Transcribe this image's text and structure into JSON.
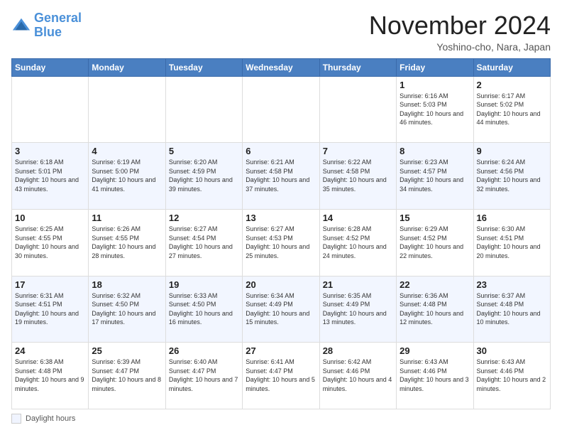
{
  "logo": {
    "line1": "General",
    "line2": "Blue"
  },
  "title": "November 2024",
  "location": "Yoshino-cho, Nara, Japan",
  "days_of_week": [
    "Sunday",
    "Monday",
    "Tuesday",
    "Wednesday",
    "Thursday",
    "Friday",
    "Saturday"
  ],
  "legend_label": "Daylight hours",
  "weeks": [
    [
      {
        "day": "",
        "info": ""
      },
      {
        "day": "",
        "info": ""
      },
      {
        "day": "",
        "info": ""
      },
      {
        "day": "",
        "info": ""
      },
      {
        "day": "",
        "info": ""
      },
      {
        "day": "1",
        "info": "Sunrise: 6:16 AM\nSunset: 5:03 PM\nDaylight: 10 hours and 46 minutes."
      },
      {
        "day": "2",
        "info": "Sunrise: 6:17 AM\nSunset: 5:02 PM\nDaylight: 10 hours and 44 minutes."
      }
    ],
    [
      {
        "day": "3",
        "info": "Sunrise: 6:18 AM\nSunset: 5:01 PM\nDaylight: 10 hours and 43 minutes."
      },
      {
        "day": "4",
        "info": "Sunrise: 6:19 AM\nSunset: 5:00 PM\nDaylight: 10 hours and 41 minutes."
      },
      {
        "day": "5",
        "info": "Sunrise: 6:20 AM\nSunset: 4:59 PM\nDaylight: 10 hours and 39 minutes."
      },
      {
        "day": "6",
        "info": "Sunrise: 6:21 AM\nSunset: 4:58 PM\nDaylight: 10 hours and 37 minutes."
      },
      {
        "day": "7",
        "info": "Sunrise: 6:22 AM\nSunset: 4:58 PM\nDaylight: 10 hours and 35 minutes."
      },
      {
        "day": "8",
        "info": "Sunrise: 6:23 AM\nSunset: 4:57 PM\nDaylight: 10 hours and 34 minutes."
      },
      {
        "day": "9",
        "info": "Sunrise: 6:24 AM\nSunset: 4:56 PM\nDaylight: 10 hours and 32 minutes."
      }
    ],
    [
      {
        "day": "10",
        "info": "Sunrise: 6:25 AM\nSunset: 4:55 PM\nDaylight: 10 hours and 30 minutes."
      },
      {
        "day": "11",
        "info": "Sunrise: 6:26 AM\nSunset: 4:55 PM\nDaylight: 10 hours and 28 minutes."
      },
      {
        "day": "12",
        "info": "Sunrise: 6:27 AM\nSunset: 4:54 PM\nDaylight: 10 hours and 27 minutes."
      },
      {
        "day": "13",
        "info": "Sunrise: 6:27 AM\nSunset: 4:53 PM\nDaylight: 10 hours and 25 minutes."
      },
      {
        "day": "14",
        "info": "Sunrise: 6:28 AM\nSunset: 4:52 PM\nDaylight: 10 hours and 24 minutes."
      },
      {
        "day": "15",
        "info": "Sunrise: 6:29 AM\nSunset: 4:52 PM\nDaylight: 10 hours and 22 minutes."
      },
      {
        "day": "16",
        "info": "Sunrise: 6:30 AM\nSunset: 4:51 PM\nDaylight: 10 hours and 20 minutes."
      }
    ],
    [
      {
        "day": "17",
        "info": "Sunrise: 6:31 AM\nSunset: 4:51 PM\nDaylight: 10 hours and 19 minutes."
      },
      {
        "day": "18",
        "info": "Sunrise: 6:32 AM\nSunset: 4:50 PM\nDaylight: 10 hours and 17 minutes."
      },
      {
        "day": "19",
        "info": "Sunrise: 6:33 AM\nSunset: 4:50 PM\nDaylight: 10 hours and 16 minutes."
      },
      {
        "day": "20",
        "info": "Sunrise: 6:34 AM\nSunset: 4:49 PM\nDaylight: 10 hours and 15 minutes."
      },
      {
        "day": "21",
        "info": "Sunrise: 6:35 AM\nSunset: 4:49 PM\nDaylight: 10 hours and 13 minutes."
      },
      {
        "day": "22",
        "info": "Sunrise: 6:36 AM\nSunset: 4:48 PM\nDaylight: 10 hours and 12 minutes."
      },
      {
        "day": "23",
        "info": "Sunrise: 6:37 AM\nSunset: 4:48 PM\nDaylight: 10 hours and 10 minutes."
      }
    ],
    [
      {
        "day": "24",
        "info": "Sunrise: 6:38 AM\nSunset: 4:48 PM\nDaylight: 10 hours and 9 minutes."
      },
      {
        "day": "25",
        "info": "Sunrise: 6:39 AM\nSunset: 4:47 PM\nDaylight: 10 hours and 8 minutes."
      },
      {
        "day": "26",
        "info": "Sunrise: 6:40 AM\nSunset: 4:47 PM\nDaylight: 10 hours and 7 minutes."
      },
      {
        "day": "27",
        "info": "Sunrise: 6:41 AM\nSunset: 4:47 PM\nDaylight: 10 hours and 5 minutes."
      },
      {
        "day": "28",
        "info": "Sunrise: 6:42 AM\nSunset: 4:46 PM\nDaylight: 10 hours and 4 minutes."
      },
      {
        "day": "29",
        "info": "Sunrise: 6:43 AM\nSunset: 4:46 PM\nDaylight: 10 hours and 3 minutes."
      },
      {
        "day": "30",
        "info": "Sunrise: 6:43 AM\nSunset: 4:46 PM\nDaylight: 10 hours and 2 minutes."
      }
    ]
  ]
}
